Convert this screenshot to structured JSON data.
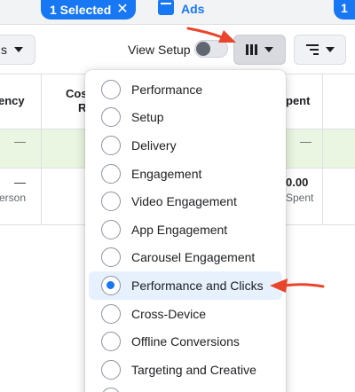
{
  "top_strip": {
    "selected_label": "1 Selected",
    "close_glyph": "✕",
    "ads_label": "Ads",
    "right_pill_label": "1"
  },
  "toolbar": {
    "left_button_label": "s",
    "view_setup_label": "View Setup",
    "view_setup_on": false,
    "columns_icon": "columns-icon",
    "breakdown_icon": "breakdown-icon"
  },
  "table": {
    "headers": {
      "left": "ency",
      "middle_line1": "Cos",
      "middle_line2": "R",
      "right": "pent"
    },
    "summary_row": {
      "dash_left": "—",
      "dash_right": "—"
    },
    "data_row": {
      "dash_left": "—",
      "sub_left": "erson",
      "value_right": "0.00",
      "sub_right": "Spent"
    }
  },
  "dropdown": {
    "items": [
      {
        "label": "Performance",
        "checked": false
      },
      {
        "label": "Setup",
        "checked": false
      },
      {
        "label": "Delivery",
        "checked": false
      },
      {
        "label": "Engagement",
        "checked": false
      },
      {
        "label": "Video Engagement",
        "checked": false
      },
      {
        "label": "App Engagement",
        "checked": false
      },
      {
        "label": "Carousel Engagement",
        "checked": false
      },
      {
        "label": "Performance and Clicks",
        "checked": true
      },
      {
        "label": "Cross-Device",
        "checked": false
      },
      {
        "label": "Offline Conversions",
        "checked": false
      },
      {
        "label": "Targeting and Creative",
        "checked": false
      },
      {
        "label": "",
        "checked": false
      }
    ]
  },
  "colors": {
    "accent": "#1877f2",
    "annotation_arrow": "#e8452c",
    "summary_row_bg": "#eaf6e1",
    "selected_item_bg": "#e7f0fd"
  }
}
